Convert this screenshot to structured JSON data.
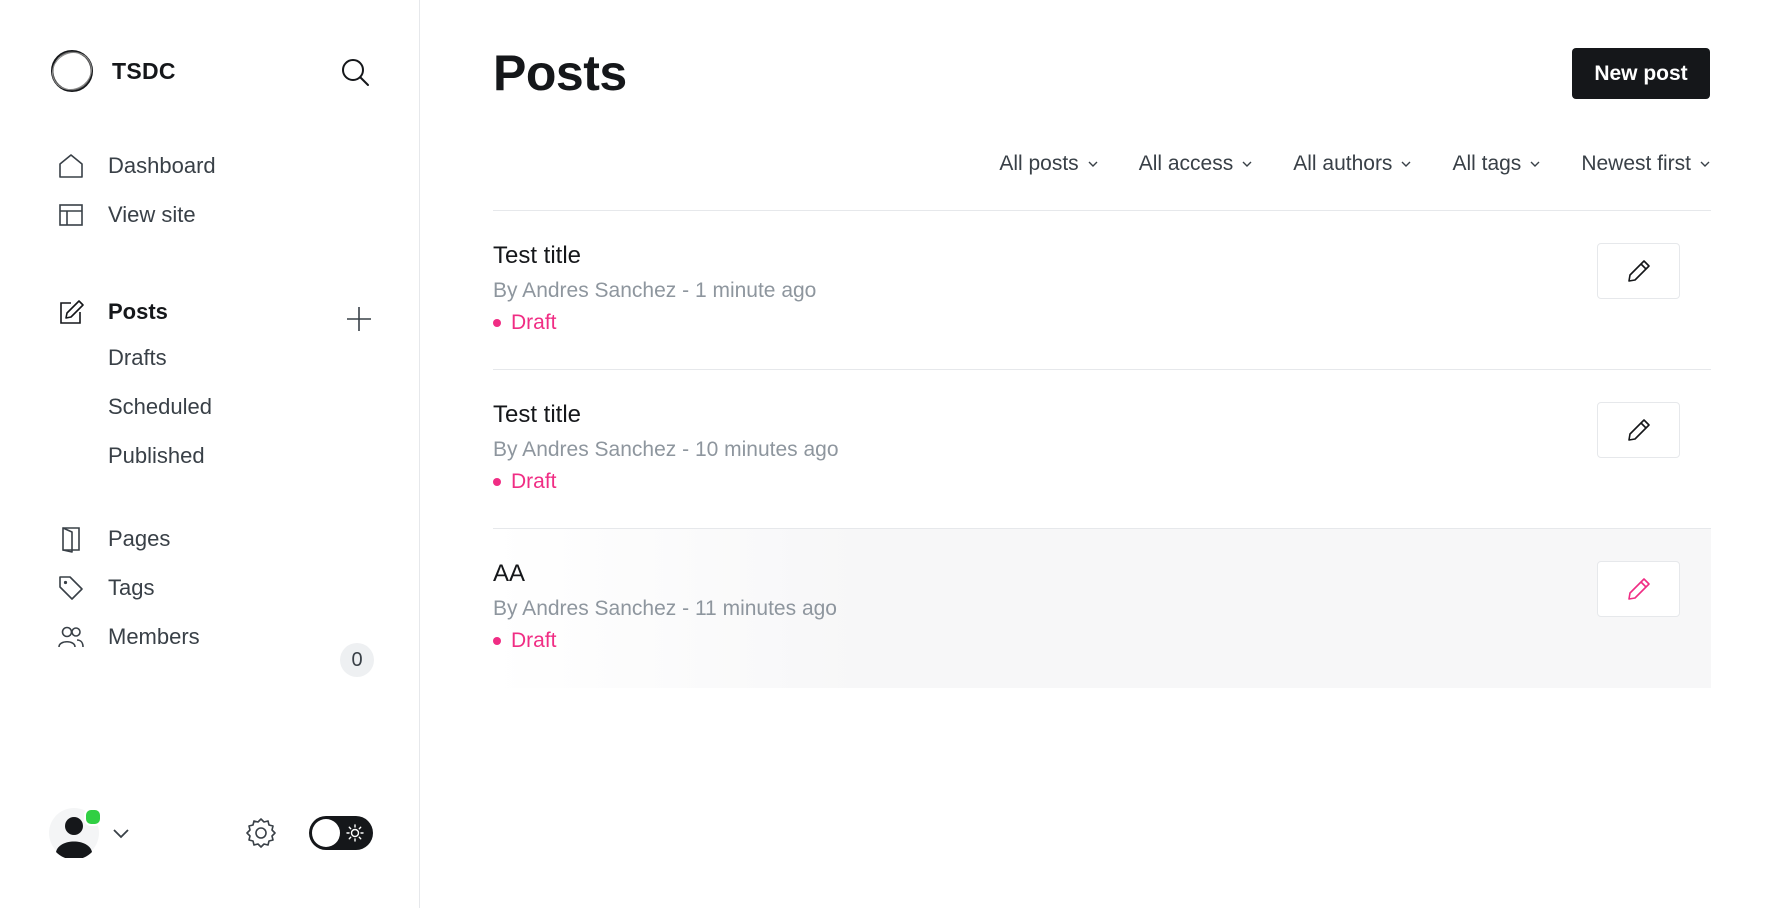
{
  "brand": {
    "name": "TSDC",
    "logo_icon": "ring-logo-icon"
  },
  "sidebar": {
    "search_icon": "search-icon",
    "primary": [
      {
        "label": "Dashboard",
        "icon": "home-icon"
      },
      {
        "label": "View site",
        "icon": "layout-icon"
      }
    ],
    "posts": {
      "label": "Posts",
      "icon": "edit-icon",
      "add_icon": "plus-icon",
      "sub_items": [
        "Drafts",
        "Scheduled",
        "Published"
      ]
    },
    "secondary": [
      {
        "label": "Pages",
        "icon": "page-icon"
      },
      {
        "label": "Tags",
        "icon": "tag-icon"
      },
      {
        "label": "Members",
        "icon": "members-icon",
        "count": "0"
      }
    ],
    "footer": {
      "avatar_icon": "user-avatar-icon",
      "settings_icon": "gear-icon",
      "theme_toggle_icon": "sun-icon",
      "online_color": "#30cf43"
    }
  },
  "main": {
    "title": "Posts",
    "new_post_label": "New post",
    "filters": [
      "All posts",
      "All access",
      "All authors",
      "All tags",
      "Newest first"
    ],
    "posts": [
      {
        "title": "Test title",
        "meta": "By Andres Sanchez - 1 minute ago",
        "status": "Draft"
      },
      {
        "title": "Test title",
        "meta": "By Andres Sanchez - 10 minutes ago",
        "status": "Draft"
      },
      {
        "title": "AA",
        "meta": "By Andres Sanchez - 11 minutes ago",
        "status": "Draft"
      }
    ]
  },
  "colors": {
    "accent": "#f02d84",
    "primary_button": "#15171a",
    "muted_text": "#8e969e"
  }
}
